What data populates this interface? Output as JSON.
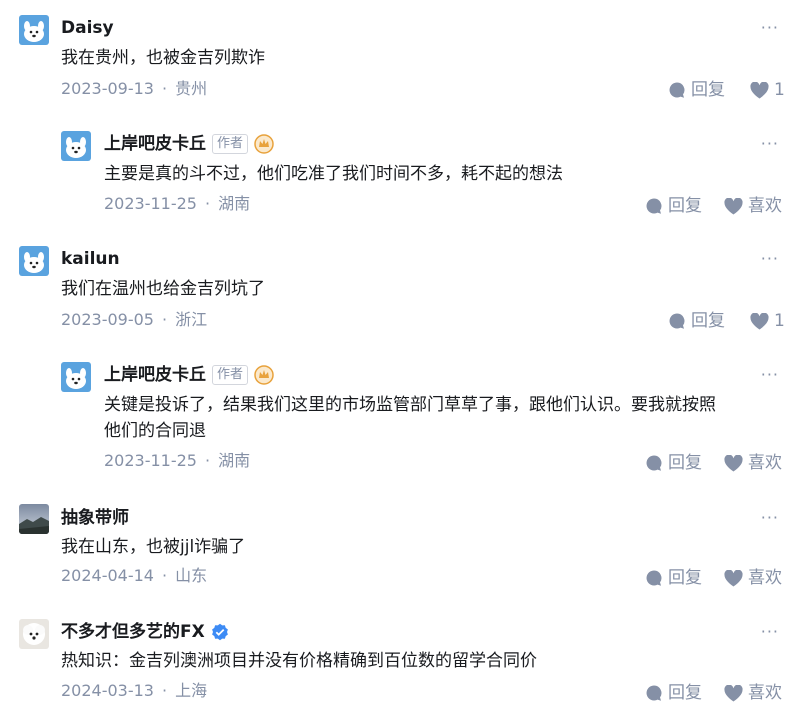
{
  "ui": {
    "more_label": "···",
    "reply_label": "回复",
    "like_label": "喜欢",
    "author_tag": "作者",
    "dot": "·"
  },
  "comments": [
    {
      "name": "Daisy",
      "text": "我在贵州，也被金吉列欺诈",
      "date": "2023-09-13",
      "location": "贵州",
      "like_count": "1"
    },
    {
      "name": "上岸吧皮卡丘",
      "text": "主要是真的斗不过，他们吃准了我们时间不多，耗不起的想法",
      "date": "2023-11-25",
      "location": "湖南"
    },
    {
      "name": "kailun",
      "text": "我们在温州也给金吉列坑了",
      "date": "2023-09-05",
      "location": "浙江",
      "like_count": "1"
    },
    {
      "name": "上岸吧皮卡丘",
      "text_line1": "关键是投诉了，结果我们这里的市场监管部门草草了事，跟他们认识。要我就按照",
      "text_line2": "他们的合同退",
      "date": "2023-11-25",
      "location": "湖南"
    },
    {
      "name": "抽象带师",
      "text": "我在山东，也被jjl诈骗了",
      "date": "2024-04-14",
      "location": "山东"
    },
    {
      "name": "不多才但多艺的FX",
      "text": "热知识：金吉列澳洲项目并没有价格精确到百位数的留学合同价",
      "date": "2024-03-13",
      "location": "上海"
    }
  ],
  "colors": {
    "text": "#191b1f",
    "meta": "#8590a6",
    "verified": "#3d8bf5",
    "crown": "#e8a23c"
  },
  "icons": [
    "dog-avatar",
    "landscape-avatar",
    "bichon-avatar",
    "more-icon",
    "reply-bubble-icon",
    "heart-icon",
    "crown-badge-icon",
    "verified-icon"
  ]
}
